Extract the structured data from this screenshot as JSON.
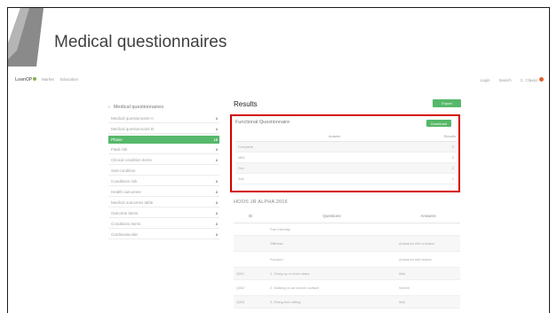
{
  "slide": {
    "title": "Medical questionnaires"
  },
  "app": {
    "logo": "LoanOP",
    "nav_left": [
      "Market",
      "Education"
    ],
    "nav_right": [
      "Login",
      "Search",
      "C. Clavijo"
    ],
    "sidebar": {
      "header": "Medical questionnaires",
      "items": [
        {
          "label": "Medical questionnaire A",
          "count": "8"
        },
        {
          "label": "Medical questionnaire B",
          "count": "8"
        },
        {
          "label": "Phase",
          "count": "19",
          "active": true
        },
        {
          "label": "Fatal risk",
          "count": "8"
        },
        {
          "label": "Clinical condition items",
          "count": "8"
        },
        {
          "label": "Sub-condition",
          "count": ""
        },
        {
          "label": "Conditions risk",
          "count": "8"
        },
        {
          "label": "Health outcomes",
          "count": "8"
        },
        {
          "label": "Medical outcomes table",
          "count": "8"
        },
        {
          "label": "Outcome items",
          "count": "8"
        },
        {
          "label": "Conditions items",
          "count": "8"
        },
        {
          "label": "Cardiovascular",
          "count": "8"
        }
      ]
    },
    "results": {
      "title": "Results",
      "top_button": "Export",
      "box_heading": "Functional Questionnaire",
      "box_button": "Download",
      "columns": [
        "Answer",
        "Results"
      ],
      "rows": [
        {
          "answer": "Complete",
          "result": "5"
        },
        {
          "answer": "Mild",
          "result": "3"
        },
        {
          "answer": "Sev",
          "result": "2"
        },
        {
          "answer": "Adv",
          "result": "1"
        }
      ]
    },
    "questions": {
      "title": "HOOS JR ALPHA 2016",
      "columns": [
        "ID",
        "Questions",
        "Answers"
      ],
      "rows": [
        {
          "id": "",
          "question": "Pain intensity",
          "answer": "",
          "tall": false
        },
        {
          "id": "",
          "question": "Stiffness",
          "answer": "Answered with a reason",
          "tall": true
        },
        {
          "id": "",
          "question": "Function",
          "answer": "Answered with reason",
          "tall": true
        },
        {
          "id": "Q001",
          "question": "1. Going up or down stairs",
          "answer": "Mild",
          "tall": false
        },
        {
          "id": "Q002",
          "question": "2. Walking on an uneven surface",
          "answer": "Severe",
          "tall": true
        },
        {
          "id": "Q003",
          "question": "3. Rising from sitting",
          "answer": "Mild",
          "tall": false
        }
      ]
    }
  }
}
